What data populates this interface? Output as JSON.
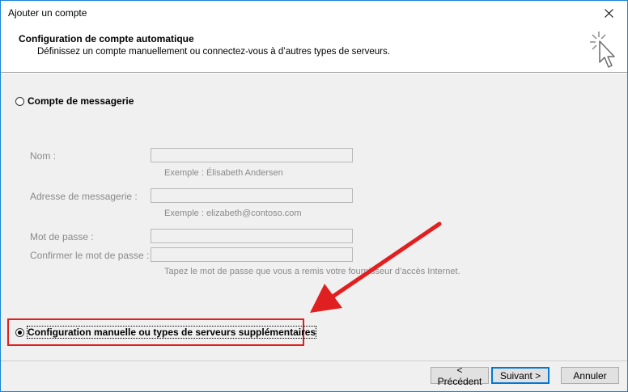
{
  "window": {
    "title": "Ajouter un compte"
  },
  "header": {
    "title": "Configuration de compte automatique",
    "subtitle": "Définissez un compte manuellement ou connectez-vous à d’autres types de serveurs."
  },
  "options": {
    "email_account": {
      "label": "Compte de messagerie",
      "selected": false
    },
    "manual_config": {
      "label": "Configuration manuelle ou types de serveurs supplémentaires",
      "selected": true
    }
  },
  "form": {
    "name": {
      "label": "Nom :",
      "value": "",
      "hint": "Exemple : Élisabeth Andersen"
    },
    "email": {
      "label": "Adresse de messagerie :",
      "value": "",
      "hint": "Exemple : elizabeth@contoso.com"
    },
    "password": {
      "label": "Mot de passe :",
      "value": ""
    },
    "confirm": {
      "label": "Confirmer le mot de passe :",
      "value": "",
      "hint": "Tapez le mot de passe que vous a remis votre fournisseur d’accès Internet."
    }
  },
  "buttons": {
    "back": "< Précédent",
    "next": "Suivant >",
    "cancel": "Annuler"
  },
  "colors": {
    "annotation": "#e02020",
    "accent": "#0078d7"
  }
}
